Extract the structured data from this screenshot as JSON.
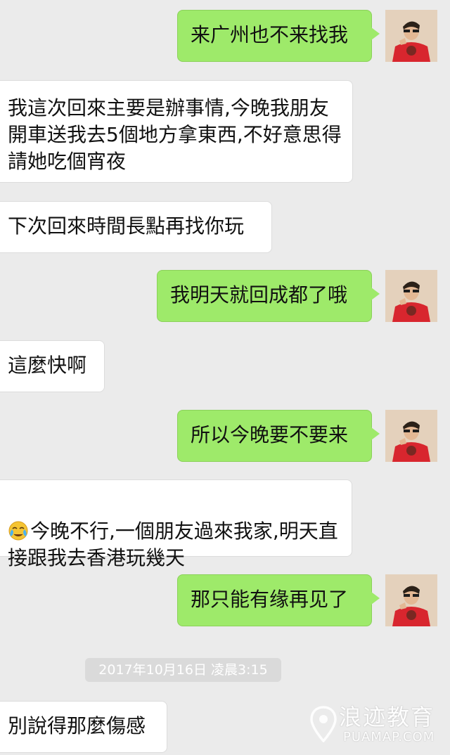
{
  "messages": [
    {
      "side": "out",
      "text": "来广州也不来找我"
    },
    {
      "side": "in",
      "text": "我這次回來主要是辦事情,今晚我朋友開車送我去5個地方拿東西,不好意思得請她吃個宵夜"
    },
    {
      "side": "in",
      "text": "下次回來時間長點再找你玩"
    },
    {
      "side": "out",
      "text": "我明天就回成都了哦"
    },
    {
      "side": "in",
      "text": "這麼快啊"
    },
    {
      "side": "out",
      "text": "所以今晚要不要来"
    },
    {
      "side": "in",
      "emoji": "crying-face",
      "text": "今晚不行,一個朋友過來我家,明天直接跟我去香港玩幾天"
    },
    {
      "side": "out",
      "text": "那只能有缘再见了"
    },
    {
      "side": "in",
      "text": "別說得那麼傷感"
    }
  ],
  "timestamp": "2017年10月16日 凌晨3:15",
  "watermark": {
    "title": "浪迹教育",
    "subtitle": "PUAMAP.COM"
  },
  "colors": {
    "background": "#ebebeb",
    "incoming_bubble": "#ffffff",
    "outgoing_bubble": "#9eea6a",
    "timestamp_bg": "#dadada"
  }
}
